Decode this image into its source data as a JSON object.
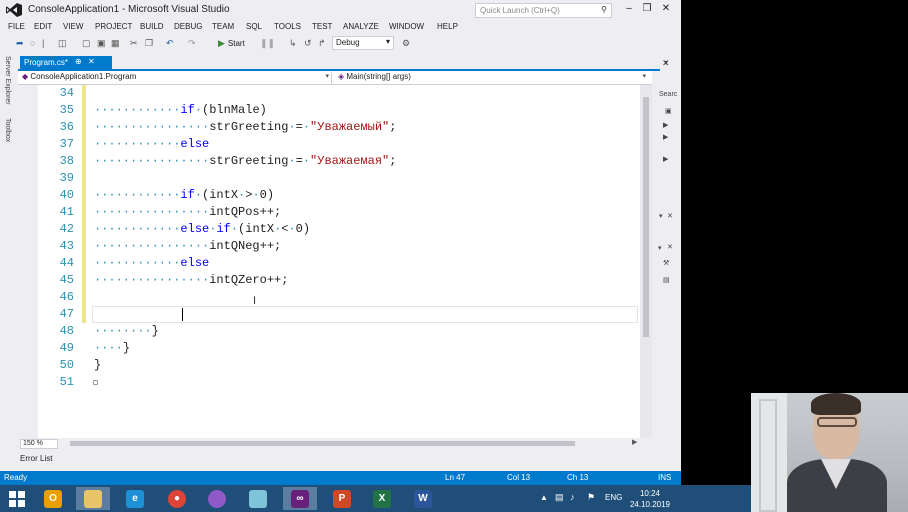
{
  "window": {
    "title": "ConsoleApplication1 - Microsoft Visual Studio",
    "quick_launch_placeholder": "Quick Launch (Ctrl+Q)"
  },
  "menu": [
    "FILE",
    "EDIT",
    "VIEW",
    "PROJECT",
    "BUILD",
    "DEBUG",
    "TEAM",
    "SQL",
    "TOOLS",
    "TEST",
    "ANALYZE",
    "WINDOW",
    "HELP"
  ],
  "toolbar": {
    "start_label": "Start",
    "config_value": "Debug"
  },
  "side_tabs": [
    "Server Explorer",
    "Toolbox"
  ],
  "doc_tab": {
    "label": "Program.cs*"
  },
  "navbar": {
    "class_value": "ConsoleApplication1.Program",
    "member_value": "Main(string[] args)"
  },
  "right_panel": {
    "search_label": "Searc"
  },
  "editor": {
    "lines": [
      {
        "num": "34",
        "parts": []
      },
      {
        "num": "35",
        "parts": [
          {
            "t": "dot",
            "v": "············"
          },
          {
            "t": "kw",
            "v": "if"
          },
          {
            "t": "dot",
            "v": "·"
          },
          {
            "t": "plain",
            "v": "(blnMale)"
          }
        ]
      },
      {
        "num": "36",
        "parts": [
          {
            "t": "dot",
            "v": "················"
          },
          {
            "t": "plain",
            "v": "strGreeting"
          },
          {
            "t": "dot",
            "v": "·"
          },
          {
            "t": "plain",
            "v": "="
          },
          {
            "t": "dot",
            "v": "·"
          },
          {
            "t": "str",
            "v": "\"Уважаемый\""
          },
          {
            "t": "plain",
            "v": ";"
          }
        ]
      },
      {
        "num": "37",
        "parts": [
          {
            "t": "dot",
            "v": "············"
          },
          {
            "t": "kw",
            "v": "else"
          }
        ]
      },
      {
        "num": "38",
        "parts": [
          {
            "t": "dot",
            "v": "················"
          },
          {
            "t": "plain",
            "v": "strGreeting"
          },
          {
            "t": "dot",
            "v": "·"
          },
          {
            "t": "plain",
            "v": "="
          },
          {
            "t": "dot",
            "v": "·"
          },
          {
            "t": "str",
            "v": "\"Уважаемая\""
          },
          {
            "t": "plain",
            "v": ";"
          }
        ]
      },
      {
        "num": "39",
        "parts": []
      },
      {
        "num": "40",
        "parts": [
          {
            "t": "dot",
            "v": "············"
          },
          {
            "t": "kw",
            "v": "if"
          },
          {
            "t": "dot",
            "v": "·"
          },
          {
            "t": "plain",
            "v": "(intX"
          },
          {
            "t": "dot",
            "v": "·"
          },
          {
            "t": "plain",
            "v": ">"
          },
          {
            "t": "dot",
            "v": "·"
          },
          {
            "t": "plain",
            "v": "0)"
          }
        ]
      },
      {
        "num": "41",
        "parts": [
          {
            "t": "dot",
            "v": "················"
          },
          {
            "t": "plain",
            "v": "intQPos++;"
          }
        ]
      },
      {
        "num": "42",
        "parts": [
          {
            "t": "dot",
            "v": "············"
          },
          {
            "t": "kw",
            "v": "else"
          },
          {
            "t": "dot",
            "v": "·"
          },
          {
            "t": "kw",
            "v": "if"
          },
          {
            "t": "dot",
            "v": "·"
          },
          {
            "t": "plain",
            "v": "(intX"
          },
          {
            "t": "dot",
            "v": "·"
          },
          {
            "t": "plain",
            "v": "<"
          },
          {
            "t": "dot",
            "v": "·"
          },
          {
            "t": "plain",
            "v": "0)"
          }
        ]
      },
      {
        "num": "43",
        "parts": [
          {
            "t": "dot",
            "v": "················"
          },
          {
            "t": "plain",
            "v": "intQNeg++;"
          }
        ]
      },
      {
        "num": "44",
        "parts": [
          {
            "t": "dot",
            "v": "············"
          },
          {
            "t": "kw",
            "v": "else"
          }
        ]
      },
      {
        "num": "45",
        "parts": [
          {
            "t": "dot",
            "v": "················"
          },
          {
            "t": "plain",
            "v": "intQZero++;"
          }
        ]
      },
      {
        "num": "46",
        "parts": []
      },
      {
        "num": "47",
        "parts": []
      },
      {
        "num": "48",
        "parts": [
          {
            "t": "dot",
            "v": "········"
          },
          {
            "t": "plain",
            "v": "}"
          }
        ]
      },
      {
        "num": "49",
        "parts": [
          {
            "t": "dot",
            "v": "····"
          },
          {
            "t": "plain",
            "v": "}"
          }
        ]
      },
      {
        "num": "50",
        "parts": [
          {
            "t": "plain",
            "v": "}"
          }
        ]
      },
      {
        "num": "51",
        "parts": []
      }
    ]
  },
  "zoom": "150 %",
  "error_list_label": "Error List",
  "status": {
    "ready": "Ready",
    "ln": "Ln 47",
    "col": "Col 13",
    "ch": "Ch 13",
    "ins": "INS"
  },
  "taskbar": {
    "lang": "ENG",
    "time": "10:24",
    "date": "24.10.2019"
  },
  "colors": {
    "accent": "#007acc",
    "keyword": "#0000ff",
    "string": "#a31515",
    "line_number": "#2b91af",
    "changed_margin": "#efe68b"
  }
}
